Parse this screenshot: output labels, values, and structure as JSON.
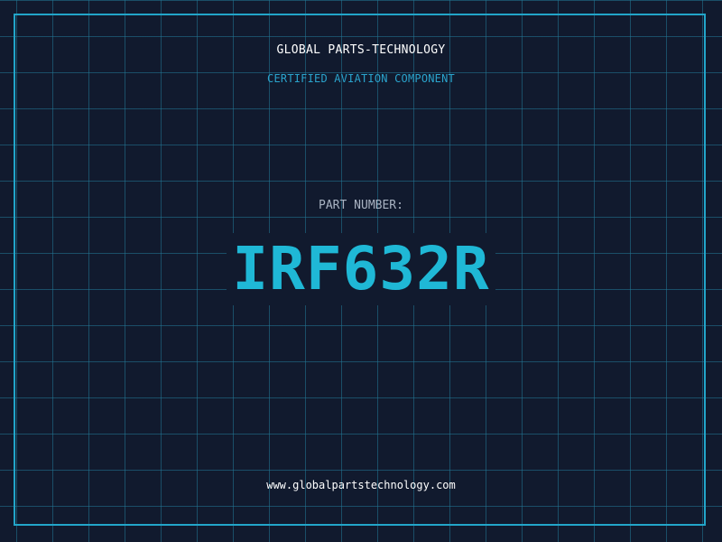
{
  "header": {
    "brand": "GLOBAL PARTS-TECHNOLOGY",
    "tagline": "CERTIFIED AVIATION COMPONENT"
  },
  "part": {
    "label": "PART NUMBER:",
    "number": "IRF632R"
  },
  "footer": {
    "website": "www.globalpartstechnology.com"
  },
  "colors": {
    "background": "#111a2e",
    "grid": "#22789a",
    "accent": "#1fb8d6",
    "frame": "#22a5c9",
    "text_primary": "#ffffff",
    "text_muted": "#a9b3c2"
  }
}
